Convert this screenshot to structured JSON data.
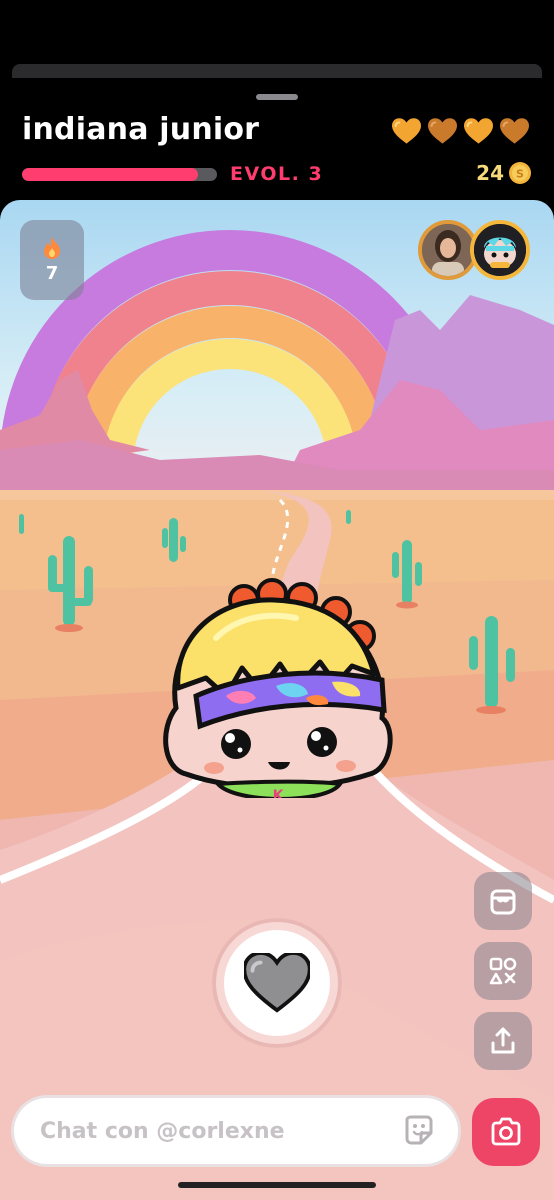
{
  "header": {
    "pet_name": "indiana junior",
    "evolution_label": "EVOL. 3",
    "evolution_progress": 0.9,
    "coins": "24",
    "hearts": [
      {
        "icon": "heart-icon",
        "color": "#f3a531"
      },
      {
        "icon": "heart-icon",
        "color": "#c97a2b"
      },
      {
        "icon": "heart-icon",
        "color": "#f3a531"
      },
      {
        "icon": "heart-icon",
        "color": "#c97a2b"
      }
    ]
  },
  "scene": {
    "streak_icon": "flame-icon",
    "streak_count": "7"
  },
  "actions": {
    "shop_icon": "shop-icon",
    "games_icon": "games-icon",
    "share_icon": "share-icon",
    "love_icon": "heart-icon"
  },
  "chat": {
    "placeholder": "Chat con @corlexne",
    "sticker_icon": "sticker-icon",
    "camera_icon": "camera-icon"
  },
  "colors": {
    "accent": "#ff3d6e",
    "coin": "#f6d97a",
    "camera": "#ee4466"
  }
}
